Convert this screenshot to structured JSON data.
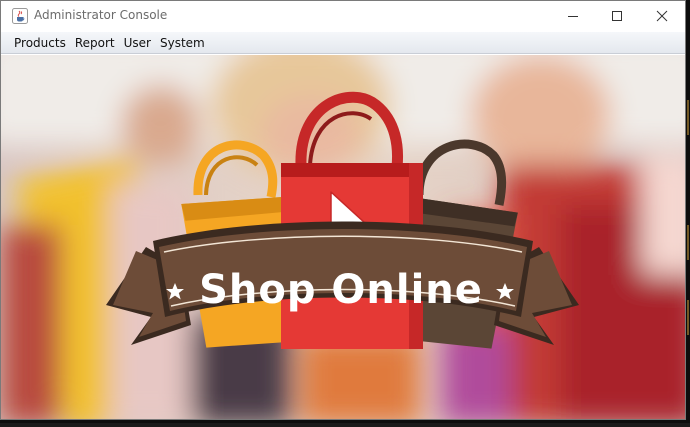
{
  "window": {
    "title": "Administrator Console",
    "icon": "java-cup-icon",
    "controls": [
      "minimize-icon",
      "maximize-icon",
      "close-icon"
    ]
  },
  "menubar": {
    "items": [
      {
        "label": "Products"
      },
      {
        "label": "Report"
      },
      {
        "label": "User"
      },
      {
        "label": "System"
      }
    ]
  },
  "banner": {
    "text": "Shop Online",
    "colors": {
      "red_bag": "#e53935",
      "orange_bag": "#f5a623",
      "brown_bag": "#5b4636",
      "ribbon": "#6d4c38",
      "ribbon_dark": "#3b2a20"
    }
  }
}
